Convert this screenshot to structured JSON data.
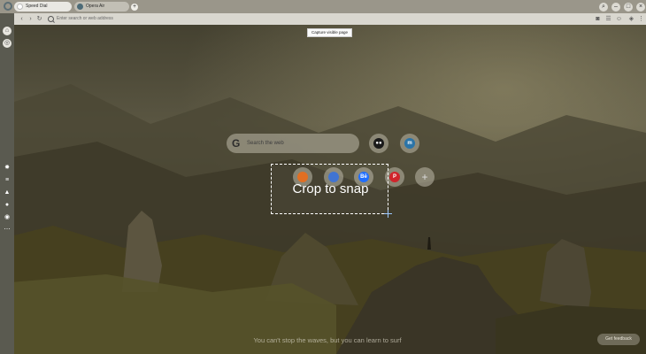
{
  "tabs": [
    {
      "label": "Speed Dial",
      "active": true
    },
    {
      "label": "Opera Air",
      "active": false
    }
  ],
  "address_bar": {
    "placeholder": "Enter search or web address"
  },
  "tooltip": "Capture visible page",
  "search": {
    "placeholder": "Search the web",
    "engine_glyph": "G"
  },
  "speed_dial": [
    {
      "name": "medium",
      "glyph": "●●",
      "color": "#1a1a1a"
    },
    {
      "name": "m-blue",
      "glyph": "m",
      "color": "#2b74a8"
    },
    {
      "name": "orange",
      "glyph": "",
      "color": "#e06a1b"
    },
    {
      "name": "blue",
      "glyph": "",
      "color": "#3a6fd1"
    },
    {
      "name": "behance",
      "glyph": "Bē",
      "color": "#1769ff"
    },
    {
      "name": "pinterest",
      "glyph": "P",
      "color": "#d0242b"
    },
    {
      "name": "add",
      "glyph": "+",
      "color": "none"
    }
  ],
  "crop": {
    "label": "Crop to snap"
  },
  "quote": "You can't stop the waves, but you can learn to surf",
  "feedback": "Get feedback",
  "colors": {
    "accent": "#9cc8ff",
    "sidebar": "#5a5a50"
  }
}
